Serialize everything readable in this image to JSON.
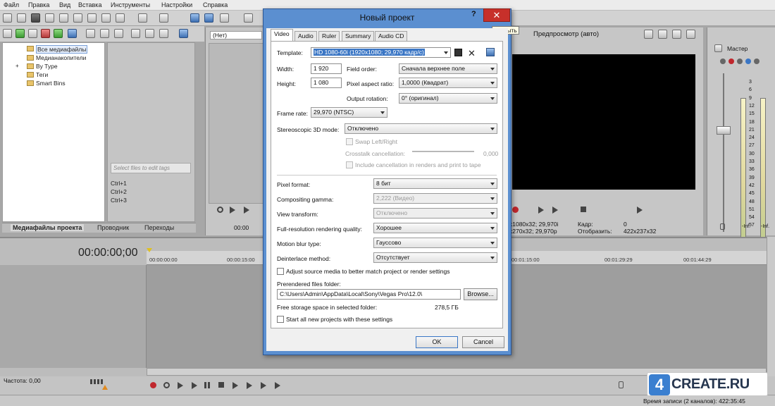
{
  "menu": [
    "Файл",
    "Правка",
    "Вид",
    "Вставка",
    "Инструменты",
    "Настройки",
    "Справка"
  ],
  "explorer": {
    "items": [
      "Все медиафайлы",
      "Медианакопители",
      "By Type",
      "Теги",
      "Smart Bins"
    ],
    "tag_placeholder": "Select files to edit tags",
    "shortcuts": [
      "Ctrl+1",
      "Ctrl+2",
      "Ctrl+3"
    ],
    "tabs": [
      "Медиафайлы проекта",
      "Проводник",
      "Переходы"
    ]
  },
  "trimmer": {
    "none_label": "(Нет)",
    "time": "00:00"
  },
  "preview": {
    "label": "Предпросмотр (авто)",
    "info_left": [
      "x1080x32; 29,970i",
      "x270x32; 29,970p"
    ],
    "kadr_label": "Кадр:",
    "kadr_value": "0",
    "display_label": "Отобразить:",
    "display_value": "422x237x32"
  },
  "master": {
    "label": "Мастер",
    "scale": [
      "3",
      "6",
      "9",
      "12",
      "15",
      "18",
      "21",
      "24",
      "27",
      "30",
      "33",
      "36",
      "39",
      "42",
      "45",
      "48",
      "51",
      "54",
      "57"
    ],
    "bottom_left": "-Inf.",
    "bottom_right": "-Inf."
  },
  "timeline": {
    "timecode": "00:00:00;00",
    "ruler": [
      "00:00:00:00",
      "00:00:15:00",
      "00:01:15:00",
      "00:01:29:29",
      "00:01:44:29"
    ],
    "rate": "Частота: 0,00",
    "record_time": "Время записи (2 каналов): 422:35:45"
  },
  "dialog": {
    "title": "Новый проект",
    "help": "?",
    "close_tooltip": "Закрыть",
    "tabs": [
      "Video",
      "Audio",
      "Ruler",
      "Summary",
      "Audio CD"
    ],
    "template_label": "Template:",
    "template_value": "HD 1080-60i (1920x1080; 29,970 кадр/с)",
    "width_label": "Width:",
    "width_value": "1 920",
    "height_label": "Height:",
    "height_value": "1 080",
    "field_order_label": "Field order:",
    "field_order_value": "Сначала верхнее поле",
    "par_label": "Pixel aspect ratio:",
    "par_value": "1,0000 (Квадрат)",
    "rotation_label": "Output rotation:",
    "rotation_value": "0° (оригинал)",
    "frame_rate_label": "Frame rate:",
    "frame_rate_value": "29,970 (NTSC)",
    "stereo_label": "Stereoscopic 3D mode:",
    "stereo_value": "Отключено",
    "swap_label": "Swap Left/Right",
    "crosstalk_label": "Crosstalk cancellation:",
    "crosstalk_value": "0,000",
    "include_cancel_label": "Include cancellation in renders and print to tape",
    "pixel_format_label": "Pixel format:",
    "pixel_format_value": "8 бит",
    "gamma_label": "Compositing gamma:",
    "gamma_value": "2,222 (Видео)",
    "view_transform_label": "View transform:",
    "view_transform_value": "Отключено",
    "quality_label": "Full-resolution rendering quality:",
    "quality_value": "Хорошее",
    "blur_label": "Motion blur type:",
    "blur_value": "Гауссово",
    "deinterlace_label": "Deinterlace method:",
    "deinterlace_value": "Отсутствует",
    "adjust_label": "Adjust source media to better match project or render settings",
    "prerender_label": "Prerendered files folder:",
    "prerender_value": "C:\\Users\\Admin\\AppData\\Local\\Sony\\Vegas Pro\\12.0\\",
    "browse_label": "Browse...",
    "free_storage_label": "Free storage space in selected folder:",
    "free_storage_value": "278,5 ГБ",
    "start_all_label": "Start all new projects with these settings",
    "ok_label": "OK",
    "cancel_label": "Cancel"
  },
  "watermark": {
    "mark": "4",
    "text": "CREATE.RU"
  }
}
